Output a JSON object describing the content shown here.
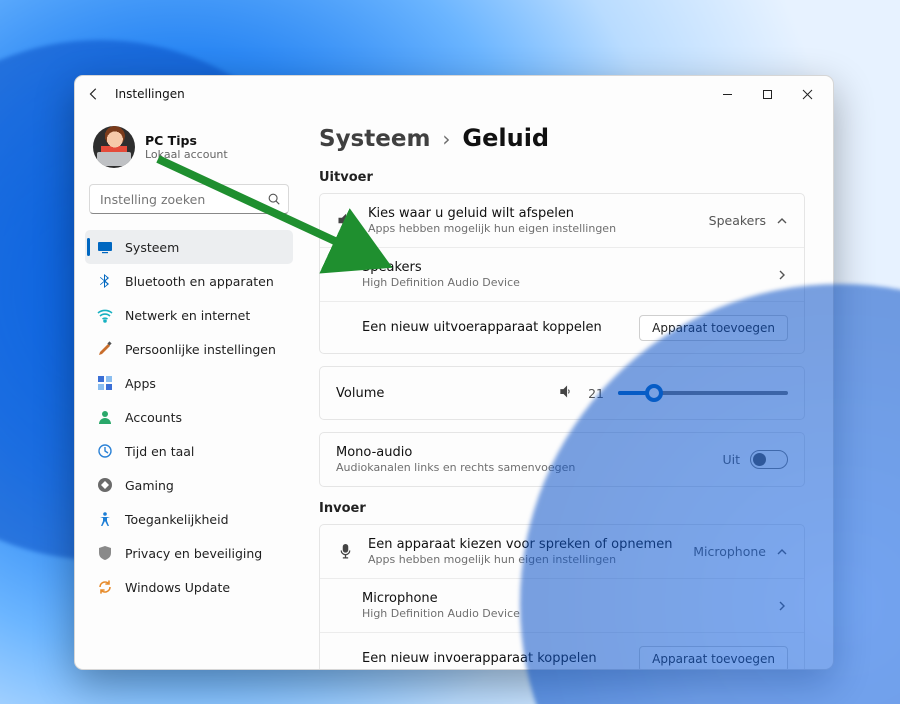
{
  "app": {
    "title": "Instellingen"
  },
  "profile": {
    "name": "PC Tips",
    "account": "Lokaal account"
  },
  "search": {
    "placeholder": "Instelling zoeken"
  },
  "sidebar": {
    "items": [
      {
        "label": "Systeem"
      },
      {
        "label": "Bluetooth en apparaten"
      },
      {
        "label": "Netwerk en internet"
      },
      {
        "label": "Persoonlijke instellingen"
      },
      {
        "label": "Apps"
      },
      {
        "label": "Accounts"
      },
      {
        "label": "Tijd en taal"
      },
      {
        "label": "Gaming"
      },
      {
        "label": "Toegankelijkheid"
      },
      {
        "label": "Privacy en beveiliging"
      },
      {
        "label": "Windows Update"
      }
    ]
  },
  "breadcrumb": {
    "level1": "Systeem",
    "level2": "Geluid"
  },
  "output": {
    "heading": "Uitvoer",
    "choose": {
      "title": "Kies waar u geluid wilt afspelen",
      "subtitle": "Apps hebben mogelijk hun eigen instellingen",
      "value": "Speakers"
    },
    "device": {
      "title": "Speakers",
      "subtitle": "High Definition Audio Device"
    },
    "add": {
      "title": "Een nieuw uitvoerapparaat koppelen",
      "button": "Apparaat toevoegen"
    },
    "volume": {
      "title": "Volume",
      "value": "21"
    },
    "mono": {
      "title": "Mono-audio",
      "subtitle": "Audiokanalen links en rechts samenvoegen",
      "state": "Uit"
    }
  },
  "input": {
    "heading": "Invoer",
    "choose": {
      "title": "Een apparaat kiezen voor spreken of opnemen",
      "subtitle": "Apps hebben mogelijk hun eigen instellingen",
      "value": "Microphone"
    },
    "device": {
      "title": "Microphone",
      "subtitle": "High Definition Audio Device"
    },
    "add": {
      "title": "Een nieuw invoerapparaat koppelen",
      "button": "Apparaat toevoegen"
    }
  }
}
